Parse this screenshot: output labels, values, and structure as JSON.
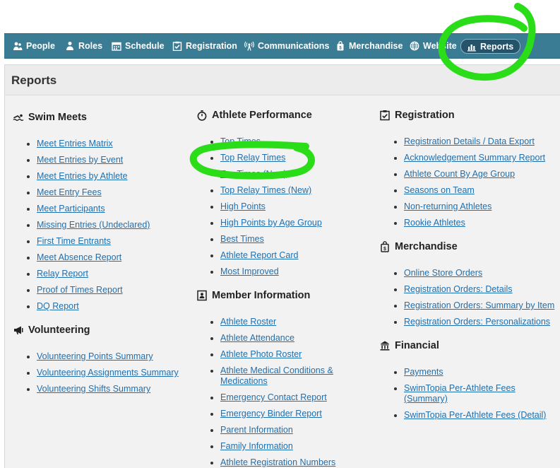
{
  "nav": {
    "items": [
      {
        "label": "People",
        "icon": "people-icon"
      },
      {
        "label": "Roles",
        "icon": "roles-icon"
      },
      {
        "label": "Schedule",
        "icon": "calendar-icon"
      },
      {
        "label": "Registration",
        "icon": "clipboard-check-icon"
      },
      {
        "label": "Communications",
        "icon": "broadcast-icon"
      },
      {
        "label": "Merchandise",
        "icon": "shopping-bag-icon"
      },
      {
        "label": "Website",
        "icon": "globe-icon"
      },
      {
        "label": "Reports",
        "icon": "bar-chart-icon",
        "active": true
      }
    ]
  },
  "page": {
    "title": "Reports"
  },
  "sections": {
    "swim_meets": {
      "heading": "Swim Meets",
      "icon": "swimmer-icon",
      "links": [
        "Meet Entries Matrix",
        "Meet Entries by Event",
        "Meet Entries by Athlete",
        "Meet Entry Fees",
        "Meet Participants",
        "Missing Entries (Undeclared)",
        "First Time Entrants",
        "Meet Absence Report",
        "Relay Report",
        "Proof of Times Report",
        "DQ Report"
      ]
    },
    "volunteering": {
      "heading": "Volunteering",
      "icon": "megaphone-icon",
      "links": [
        "Volunteering Points Summary",
        "Volunteering Assignments Summary",
        "Volunteering Shifts Summary"
      ]
    },
    "athlete_performance": {
      "heading": "Athlete Performance",
      "icon": "stopwatch-icon",
      "links": [
        "Top Times",
        "Top Relay Times",
        "Top Times (New)",
        "Top Relay Times (New)",
        "High Points",
        "High Points by Age Group",
        "Best Times",
        "Athlete Report Card",
        "Most Improved"
      ]
    },
    "member_information": {
      "heading": "Member Information",
      "icon": "id-card-icon",
      "links": [
        "Athlete Roster",
        "Athlete Attendance",
        "Athlete Photo Roster",
        "Athlete Medical Conditions &",
        "Medications",
        "Emergency Contact Report",
        "Emergency Binder Report",
        "Parent Information",
        "Family Information",
        "Athlete Registration Numbers"
      ]
    },
    "registration": {
      "heading": "Registration",
      "icon": "clipboard-check-icon",
      "links": [
        "Registration Details / Data Export",
        "Acknowledgement Summary Report",
        "Athlete Count By Age Group",
        "Seasons on Team",
        "Non-returning Athletes",
        "Rookie Athletes"
      ]
    },
    "merchandise": {
      "heading": "Merchandise",
      "icon": "shopping-bag-icon",
      "links": [
        "Online Store Orders",
        "Registration Orders: Details",
        "Registration Orders: Summary by Item",
        "Registration Orders: Personalizations"
      ]
    },
    "financial": {
      "heading": "Financial",
      "icon": "bank-icon",
      "links": [
        "Payments",
        "SwimTopia Per-Athlete Fees",
        "(Summary)",
        "SwimTopia Per-Athlete Fees (Detail)"
      ]
    }
  },
  "annotations": {
    "color": "#2bdc18"
  }
}
